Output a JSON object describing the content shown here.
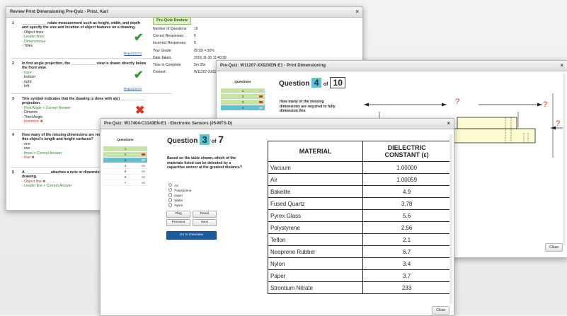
{
  "review": {
    "title": "Review Print Dimensioning Pre-Quiz - Prinz, Karl",
    "close": "×",
    "report_error": "Report Error",
    "questions": [
      {
        "num": "1",
        "text": "____________ relate measurement such as height, width, and depth and specify the size and location of object features on a drawing.",
        "options": [
          "- Object lines",
          "- Leader lines",
          "- Dimensions✔",
          "- Titles"
        ]
      },
      {
        "num": "2",
        "text": "In first angle projection, the ____________ view is drawn directly below the front view.",
        "options": [
          "- top✔",
          "- bottom",
          "- right",
          "- left"
        ]
      },
      {
        "num": "3",
        "text": "This symbol indicates that the drawing is done with a(n) ____________ projection.",
        "options": [
          "- First Angle > Correct Answer",
          "- Dimetric",
          "- Third Angle",
          "- Isometric ✖"
        ]
      },
      {
        "num": "4",
        "text": "How many of the missing dimensions are required to fully dimension this object's length and height surfaces?",
        "options": [
          "- one",
          "- two",
          "- three > Correct Answer",
          "- four ✖"
        ]
      },
      {
        "num": "5",
        "text": "A ____________ attaches a note or dimension to a feature on a drawing.",
        "options": [
          "- Object line ✖",
          "- Leader line > Correct Answer"
        ]
      }
    ],
    "summary": {
      "heading": "Pre-Quiz Review",
      "rows": [
        {
          "k": "Number of Questions:",
          "v": "10"
        },
        {
          "k": "Correct Responses:",
          "v": "5"
        },
        {
          "k": "Incorrect Responses:",
          "v": "5"
        },
        {
          "k": "Your Grade:",
          "v": "(5/10) = 50%"
        },
        {
          "k": "Date Taken:",
          "v": "2016-11-30 11:40:39"
        },
        {
          "k": "Time to Complete:",
          "v": "5m 35s"
        },
        {
          "k": "Content:",
          "v": "W11207-XX02..."
        }
      ]
    }
  },
  "print_quiz": {
    "title": "Pre-Quiz: W11207-XX02XEN-E1 - Print Dimensioning",
    "close": "×",
    "questions_heading": "Questions",
    "question_word": "Question",
    "current": "4",
    "of_word": "of",
    "total": "10",
    "nav": [
      "1",
      "2",
      "3",
      "4"
    ],
    "body": "How many of the missing dimensions are required to fully dimension this",
    "close_button": "Close",
    "question_mark": "?"
  },
  "sensor_quiz": {
    "title": "Pre-Quiz: W17404-C3143EN-E1 - Electronic Sensors (05-MTS-D)",
    "close": "×",
    "questions_heading": "Questions",
    "question_word": "Question",
    "current": "3",
    "of_word": "of",
    "total": "7",
    "nav": [
      "1",
      "2",
      "3",
      "4",
      "5",
      "6",
      "7"
    ],
    "body": "Based on the table shown, which of the materials listed can be detected by a capacitive sensor at the greatest distance?",
    "options": [
      "Air",
      "Polystyrene",
      "paper",
      "Water",
      "Nylon"
    ],
    "buttons": {
      "flag": "Flag",
      "reset": "Reset",
      "previous": "Previous",
      "next": "Next",
      "overview": "Go to Overview"
    },
    "table": {
      "col1": "MATERIAL",
      "col2a": "DIELECTRIC",
      "col2b": "CONSTANT (ε)",
      "rows": [
        [
          "Vacuum",
          "1.00000"
        ],
        [
          "Air",
          "1.00059"
        ],
        [
          "Bakelite",
          "4.9"
        ],
        [
          "Fused Quartz",
          "3.78"
        ],
        [
          "Pyrex Glass",
          "5.6"
        ],
        [
          "Polystyrene",
          "2.56"
        ],
        [
          "Teflon",
          "2.1"
        ],
        [
          "Neoprene Rubber",
          "6.7"
        ],
        [
          "Nylon",
          "3.4"
        ],
        [
          "Paper",
          "3.7"
        ],
        [
          "Strontium Nitrate",
          "233"
        ]
      ]
    },
    "close_button": "Close"
  },
  "colors": {
    "current": "#5cc3cf",
    "answered": "#c8e3a6",
    "flag": "#d23a2a",
    "primary": "#1a5ba0"
  }
}
